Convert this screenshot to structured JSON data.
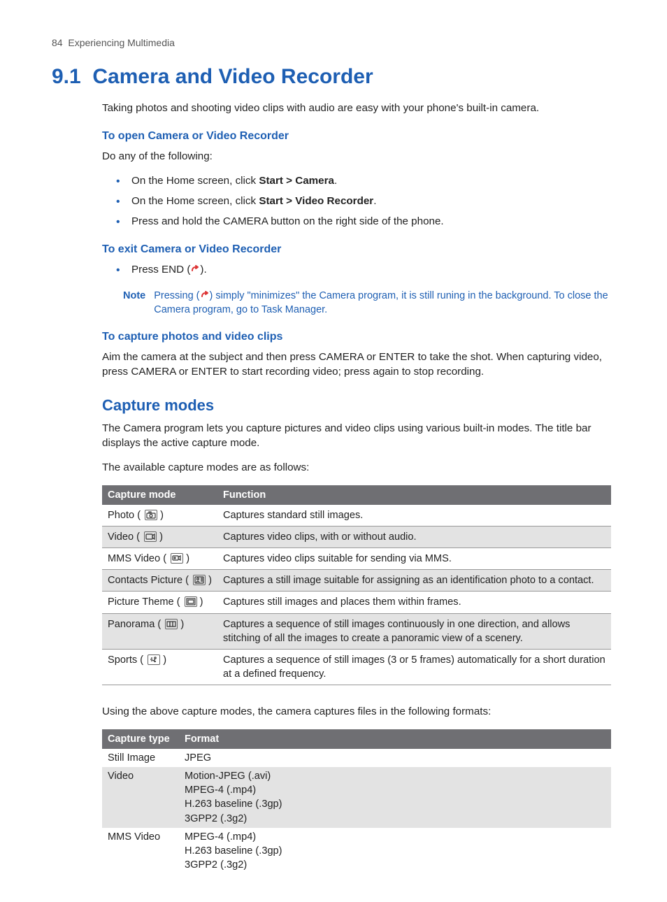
{
  "header": {
    "page_num": "84",
    "chapter": "Experiencing Multimedia"
  },
  "section": {
    "number": "9.1",
    "title": "Camera and Video Recorder"
  },
  "intro": "Taking photos and shooting video clips with audio are easy with your phone's built-in camera.",
  "open": {
    "heading": "To open Camera or Video Recorder",
    "lead": "Do any of the following:",
    "items": [
      {
        "pre": "On the Home screen, click ",
        "bold": "Start > Camera",
        "post": "."
      },
      {
        "pre": "On the Home screen, click ",
        "bold": "Start > Video Recorder",
        "post": "."
      },
      {
        "pre": "Press and hold the CAMERA button on the right side of the phone.",
        "bold": "",
        "post": ""
      }
    ]
  },
  "exit": {
    "heading": "To exit Camera or Video Recorder",
    "item_pre": "Press END (",
    "item_post": ")."
  },
  "note": {
    "label": "Note",
    "text_pre": "Pressing (",
    "text_post": ") simply \"minimizes\" the Camera program, it is still runing in the background. To close the Camera program, go to Task Manager."
  },
  "capture_clips": {
    "heading": "To capture photos and video clips",
    "text": "Aim the camera at the subject and then press CAMERA or ENTER to take the shot. When capturing video, press CAMERA or ENTER to start recording video; press again to stop recording."
  },
  "capture_modes": {
    "heading": "Capture modes",
    "p1": "The Camera program lets you capture pictures and video clips using various built-in modes. The title bar displays the active capture mode.",
    "p2": "The available capture modes are as follows:",
    "headers": {
      "mode": "Capture mode",
      "func": "Function"
    },
    "rows": [
      {
        "name": "Photo",
        "func": "Captures standard still images.",
        "icon": "camera"
      },
      {
        "name": "Video",
        "func": "Captures video clips, with or without audio.",
        "icon": "video"
      },
      {
        "name": "MMS Video",
        "func": "Captures video clips suitable for sending via MMS.",
        "icon": "mms"
      },
      {
        "name": "Contacts Picture",
        "func": "Captures a still image suitable for assigning as an identification photo to a contact.",
        "icon": "contact"
      },
      {
        "name": "Picture Theme",
        "func": "Captures still images and places them within frames.",
        "icon": "theme"
      },
      {
        "name": "Panorama",
        "func": "Captures a sequence of still images continuously in one direction, and allows stitching of all the images to create a panoramic view of a scenery.",
        "icon": "panorama"
      },
      {
        "name": "Sports",
        "func": "Captures a sequence of still images (3 or 5 frames) automatically for a short duration at a defined frequency.",
        "icon": "sports"
      }
    ],
    "after": "Using the above capture modes, the camera captures files in the following formats:"
  },
  "formats": {
    "headers": {
      "type": "Capture type",
      "fmt": "Format"
    },
    "rows": [
      {
        "type": "Still Image",
        "fmts": [
          "JPEG"
        ]
      },
      {
        "type": "Video",
        "fmts": [
          "Motion-JPEG (.avi)",
          "MPEG-4 (.mp4)",
          "H.263 baseline (.3gp)",
          "3GPP2 (.3g2)"
        ]
      },
      {
        "type": "MMS Video",
        "fmts": [
          "MPEG-4 (.mp4)",
          "H.263 baseline (.3gp)",
          "3GPP2 (.3g2)"
        ]
      }
    ]
  }
}
